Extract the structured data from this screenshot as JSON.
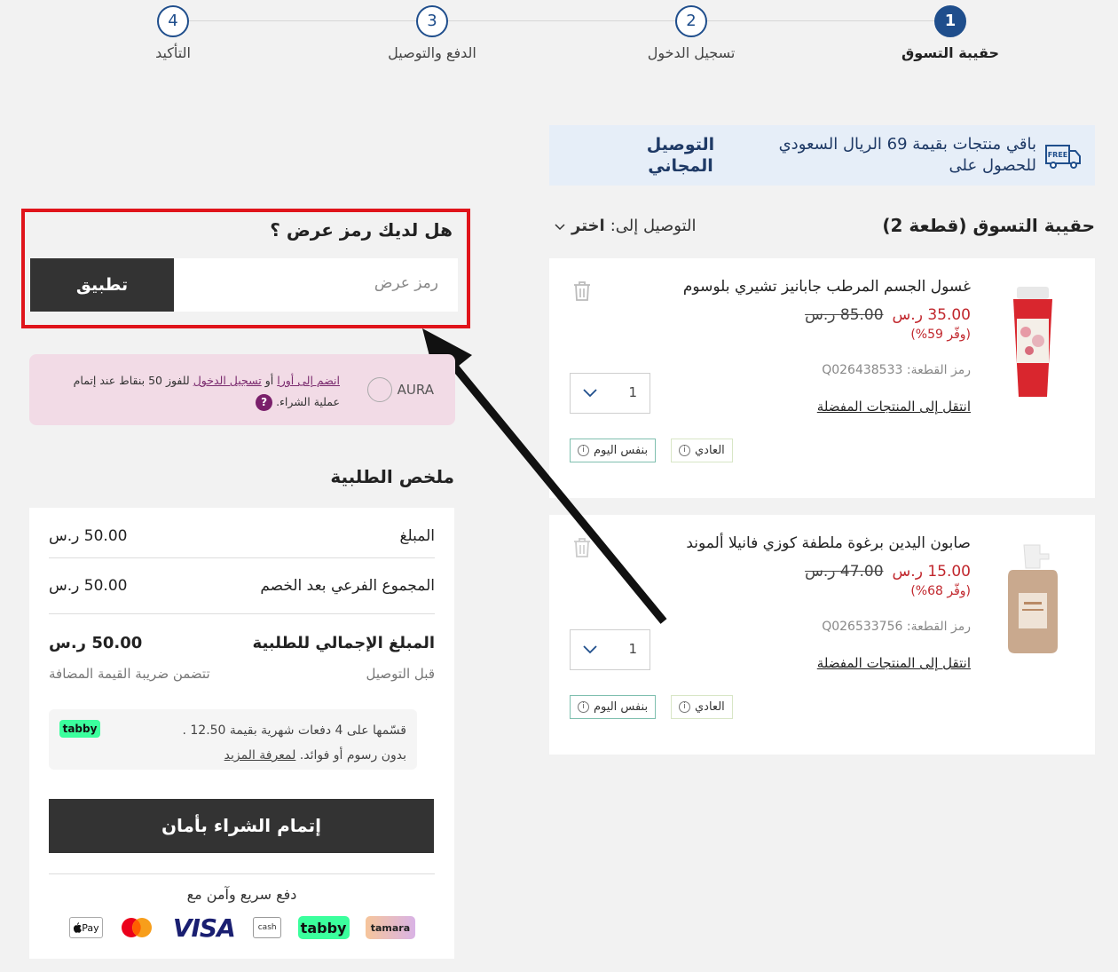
{
  "stepper": {
    "steps": [
      {
        "number": "1",
        "label": "حقيبة التسوق",
        "active": true
      },
      {
        "number": "2",
        "label": "تسجيل الدخول",
        "active": false
      },
      {
        "number": "3",
        "label": "الدفع والتوصيل",
        "active": false
      },
      {
        "number": "4",
        "label": "التأكيد",
        "active": false
      }
    ]
  },
  "banner": {
    "icon": "free-delivery-truck-icon",
    "icon_text": "FREE",
    "text": "باقي منتجات بقيمة 69 الريال السعودي للحصول على",
    "strong": "التوصيل المجاني"
  },
  "cart": {
    "title": "حقيبة التسوق (قطعة 2)",
    "delivery_label": "التوصيل إلى:",
    "delivery_value": "اختر",
    "items": [
      {
        "name": "غسول الجسم المرطب جابانيز تشيري بلوسوم",
        "old_price": "85.00 ر.س",
        "new_price": "35.00 ر.س",
        "save": "(وفّر 59%)",
        "sku": "رمز القطعة: Q026438533",
        "fav": "انتقل إلى المنتجات المفضلة",
        "qty": "1",
        "opt_normal": "العادي",
        "opt_sameday": "بنفس اليوم"
      },
      {
        "name": "صابون اليدين برغوة ملطفة كوزي فانيلا ألموند",
        "old_price": "47.00 ر.س",
        "new_price": "15.00 ر.س",
        "save": "(وفّر 68%)",
        "sku": "رمز القطعة: Q026533756",
        "fav": "انتقل إلى المنتجات المفضلة",
        "qty": "1",
        "opt_normal": "العادي",
        "opt_sameday": "بنفس اليوم"
      }
    ]
  },
  "promo": {
    "title": "هل لديك رمز عرض ؟",
    "placeholder": "رمز عرض",
    "apply": "تطبيق"
  },
  "aura": {
    "logo": "AURA",
    "join": "انضم إلى أورا",
    "or": "أو",
    "login": "تسجيل الدخول",
    "rest": "للفوز 50 بنقاط عند إتمام عملية الشراء.",
    "help": "?"
  },
  "summary": {
    "title": "ملخص الطلبية",
    "amount_label": "المبلغ",
    "amount_value": "50.00 ر.س",
    "subtotal_label": "المجموع الفرعي بعد الخصم",
    "subtotal_value": "50.00 ر.س",
    "total_label": "المبلغ الإجمالي للطلبية",
    "total_value": "50.00 ر.س",
    "before_delivery": "قبل التوصيل",
    "vat": "تتضمن ضريبة القيمة المضافة",
    "tabby_text": "قسّمها على 4 دفعات شهرية بقيمة 12.50 .",
    "tabby_text2": "بدون رسوم أو فوائد.",
    "tabby_link": "لمعرفة المزيد",
    "tabby_badge": "tabby",
    "checkout": "إتمام الشراء بأمان",
    "pay_title": "دفع سريع وآمن مع",
    "logos": [
      "applepay",
      "mastercard",
      "VISA",
      "cash",
      "tabby",
      "tamara"
    ],
    "applepay_text": "Pay",
    "visa_text": "VISA",
    "cash_text": "cash",
    "tabby_logo": "tabby",
    "tamara_logo": "tamara"
  },
  "colors": {
    "accent": "#1f4e8c",
    "price_red": "#c1272d",
    "highlight_red": "#e0141b",
    "dark_button": "#333333"
  }
}
